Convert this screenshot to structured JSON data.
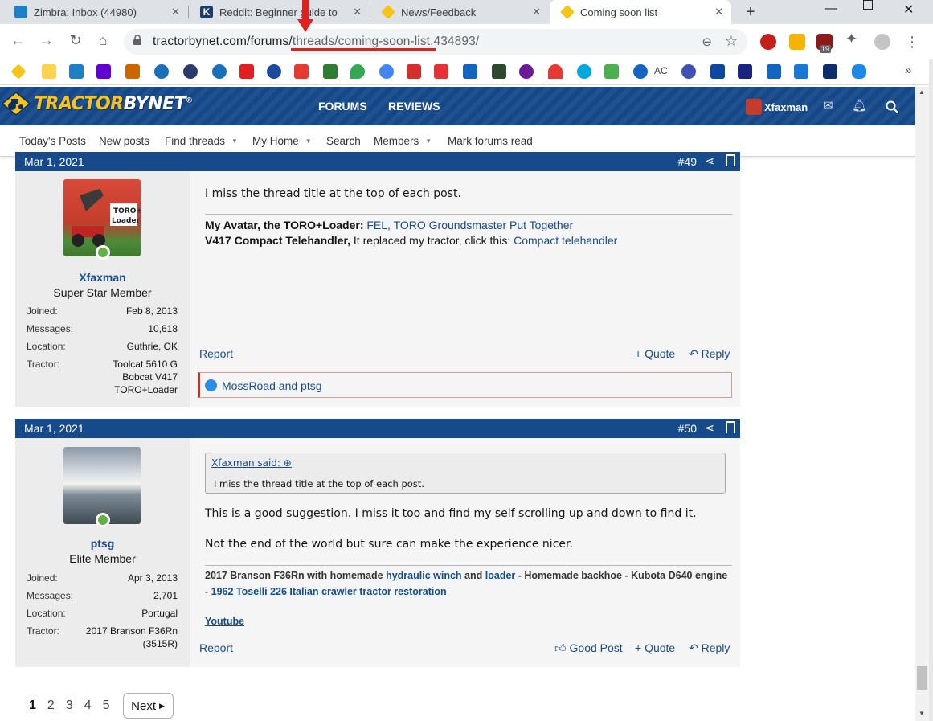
{
  "browser": {
    "tabs": [
      {
        "title": "Zimbra: Inbox (44980)",
        "color": "#1f7fc5"
      },
      {
        "title": "Reddit: Beginner guide to",
        "color": "#1c3c6e"
      },
      {
        "title": "News/Feedback",
        "color": "#f5c518"
      },
      {
        "title": "Coming soon list",
        "color": "#f5c518"
      }
    ],
    "url_host": "tractorbynet.com/forums/",
    "url_path": "threads/coming-soon-list.434893/",
    "extension_badge": "19",
    "bookmarks_ac_label": "AC",
    "bookmarks_more": "»"
  },
  "site": {
    "logo_first": "TRACTOR",
    "logo_second": "BYNET",
    "logo_mark": "®",
    "nav": {
      "forums": "FORUMS",
      "reviews": "REVIEWS"
    },
    "username": "Xfaxman",
    "subnav": {
      "todays_posts": "Today's Posts",
      "new_posts": "New posts",
      "find_threads": "Find threads",
      "my_home": "My Home",
      "search": "Search",
      "members": "Members",
      "mark_read": "Mark forums read"
    },
    "accent": "#174a8b"
  },
  "posts": [
    {
      "date": "Mar 1, 2021",
      "number": "#49",
      "author": "Xfaxman",
      "user_title": "Super Star Member",
      "stats": {
        "joined_label": "Joined:",
        "joined": "Feb 8, 2013",
        "messages_label": "Messages:",
        "messages": "10,618",
        "location_label": "Location:",
        "location": "Guthrie, OK",
        "tractor_label": "Tractor:",
        "tractor_1": "Toolcat 5610 G",
        "tractor_2": "Bobcat V417",
        "tractor_3": "TORO+Loader"
      },
      "body": "I miss the thread title at the top of each post.",
      "sig_line1_bold": "My Avatar, the TORO+Loader:",
      "sig_line1_links": "FEL, TORO Groundsmaster Put Together",
      "sig_line2_bold": "V417 Compact Telehandler,",
      "sig_line2_text": "It replaced my tractor, click this:",
      "sig_line2_link": "Compact telehandler",
      "report": "Report",
      "quote": "+ Quote",
      "reply": "Reply",
      "reactions": "MossRoad and ptsg"
    },
    {
      "date": "Mar 1, 2021",
      "number": "#50",
      "author": "ptsg",
      "user_title": "Elite Member",
      "stats": {
        "joined_label": "Joined:",
        "joined": "Apr 3, 2013",
        "messages_label": "Messages:",
        "messages": "2,701",
        "location_label": "Location:",
        "location": "Portugal",
        "tractor_label": "Tractor:",
        "tractor_1": "2017 Branson F36Rn",
        "tractor_2": "(3515R)"
      },
      "quote_author": "Xfaxman said:",
      "quote_body": "I miss the thread title at the top of each post.",
      "body_1": "This is a good suggestion. I miss it too and find my self scrolling up and down to find it.",
      "body_2": "Not the end of the world but sure can make the experience nicer.",
      "sig_a": "2017 Branson F36Rn with homemade",
      "sig_link_winch": "hydraulic winch",
      "sig_and": "and",
      "sig_link_loader": "loader",
      "sig_b": "- Homemade backhoe - Kubota D640 engine",
      "sig_dash": "-",
      "sig_link_toselli": "1962 Toselli 226 Italian crawler tractor restoration",
      "sig_youtube": "Youtube",
      "report": "Report",
      "good_post": "Good Post",
      "quote": "+ Quote",
      "reply": "Reply"
    }
  ],
  "pagination": {
    "pages": [
      "1",
      "2",
      "3",
      "4",
      "5"
    ],
    "current": "1",
    "next": "Next"
  }
}
